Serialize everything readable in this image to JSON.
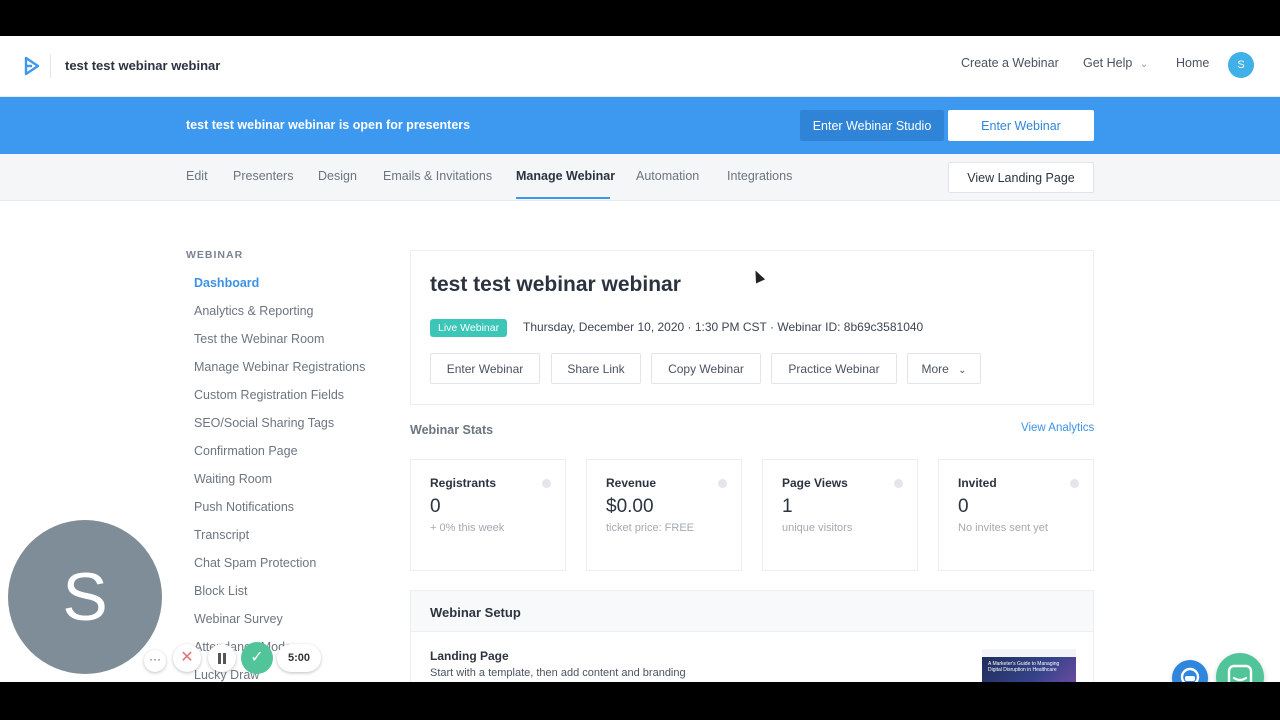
{
  "app": {
    "title": "test test webinar webinar",
    "brand_color": "#3d99ef"
  },
  "nav": {
    "create": "Create a Webinar",
    "help": "Get Help",
    "help_chevron": "⌄",
    "home": "Home",
    "avatar_initial": "S"
  },
  "banner": {
    "text": "test test webinar webinar is open for presenters",
    "studio_button": "Enter Webinar Studio",
    "enter_button": "Enter Webinar"
  },
  "tabs": {
    "items": [
      "Edit",
      "Presenters",
      "Design",
      "Emails & Invitations",
      "Manage Webinar",
      "Automation",
      "Integrations"
    ],
    "active": "Manage Webinar",
    "landing_button": "View Landing Page"
  },
  "sidebar": {
    "heading": "WEBINAR",
    "items": [
      "Dashboard",
      "Analytics & Reporting",
      "Test the Webinar Room",
      "Manage Webinar Registrations",
      "Custom Registration Fields",
      "SEO/Social Sharing Tags",
      "Confirmation Page",
      "Waiting Room",
      "Push Notifications",
      "Transcript",
      "Chat Spam Protection",
      "Block List",
      "Webinar Survey",
      "Attendance Mode",
      "Lucky Draw"
    ],
    "active": "Dashboard"
  },
  "webinar": {
    "title": "test test webinar webinar",
    "status": "Live Webinar",
    "meta": "Thursday, December 10, 2020 · 1:30 PM CST · Webinar ID: 8b69c3581040",
    "actions": [
      "Enter Webinar",
      "Share Link",
      "Copy Webinar",
      "Practice Webinar",
      "More"
    ],
    "more_chevron": "⌄"
  },
  "stats": {
    "label": "Webinar Stats",
    "view_analytics": "View Analytics",
    "cards": [
      {
        "label": "Registrants",
        "value": "0",
        "sub": "+ 0% this week"
      },
      {
        "label": "Revenue",
        "value": "$0.00",
        "sub": "ticket price: FREE"
      },
      {
        "label": "Page Views",
        "value": "1",
        "sub": "unique visitors"
      },
      {
        "label": "Invited",
        "value": "0",
        "sub": "No invites sent yet"
      }
    ]
  },
  "setup": {
    "title": "Webinar Setup",
    "landing_title": "Landing Page",
    "landing_desc": "Start with a template, then add content and branding",
    "thumb_text": "A Marketer's Guide to Managing Digital Disruption in Healthcare"
  },
  "recorder": {
    "avatar_initial": "S",
    "dots": "···",
    "cancel": "✕",
    "done": "✓",
    "time": "5:00"
  }
}
